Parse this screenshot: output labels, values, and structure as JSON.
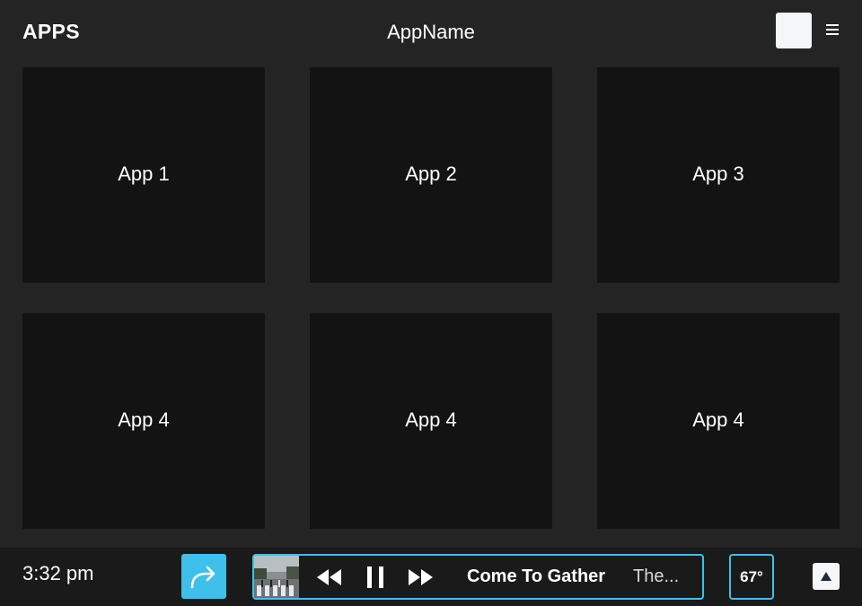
{
  "header": {
    "section_title": "APPS",
    "app_name": "AppName"
  },
  "apps": [
    {
      "label": "App 1"
    },
    {
      "label": "App 2"
    },
    {
      "label": "App 3"
    },
    {
      "label": "App 4"
    },
    {
      "label": "App 4"
    },
    {
      "label": "App 4"
    }
  ],
  "status_bar": {
    "time": "3:32 pm",
    "temperature": "67°"
  },
  "player": {
    "track_title": "Come To Gather",
    "artist": "The...",
    "state": "playing"
  },
  "colors": {
    "accent": "#3fc0ea",
    "background": "#242424",
    "tile": "#131313",
    "bottom_bar": "#1a1a1a"
  },
  "icons": {
    "navigation": "redo-arrow-icon",
    "rewind": "rewind-icon",
    "pause": "pause-icon",
    "fast_forward": "fast-forward-icon",
    "eject": "up-triangle-icon",
    "menu": "hamburger-menu-icon"
  }
}
